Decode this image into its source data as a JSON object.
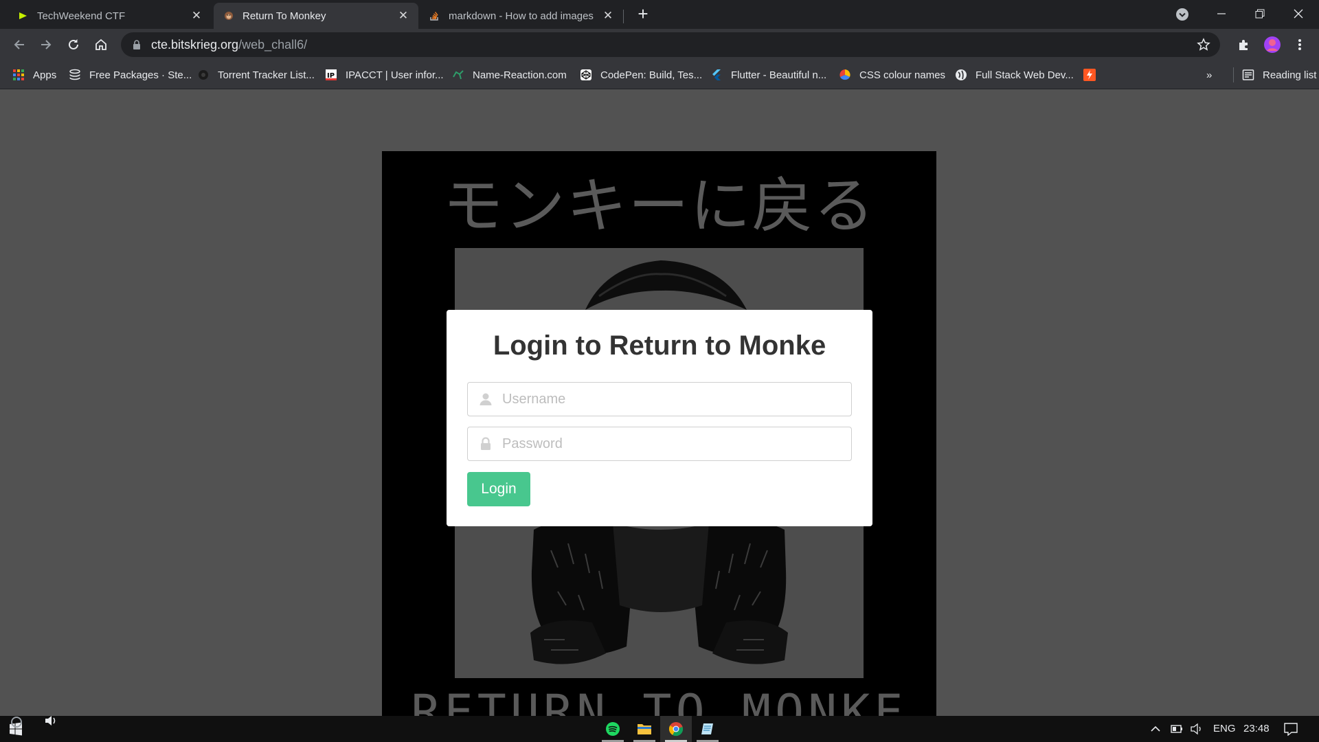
{
  "tabs": [
    {
      "title": "TechWeekend CTF",
      "active": false
    },
    {
      "title": "Return To Monkey",
      "active": true
    },
    {
      "title": "markdown - How to add images",
      "active": false
    }
  ],
  "omnibox": {
    "host": "cte.bitskrieg.org",
    "path": "/web_chall6/"
  },
  "bookmarks": [
    {
      "label": "Apps",
      "icon": "apps-grid-icon"
    },
    {
      "label": "Free Packages · Ste...",
      "icon": "stack-icon"
    },
    {
      "label": "Torrent Tracker List...",
      "icon": "torrent-icon"
    },
    {
      "label": "IPACCT | User infor...",
      "icon": "ipacct-icon"
    },
    {
      "label": "Name-Reaction.com",
      "icon": "molecule-icon"
    },
    {
      "label": "CodePen: Build, Tes...",
      "icon": "codepen-icon"
    },
    {
      "label": "Flutter - Beautiful n...",
      "icon": "flutter-icon"
    },
    {
      "label": "CSS colour names",
      "icon": "color-wheel-icon"
    },
    {
      "label": "Full Stack Web Dev...",
      "icon": "globe-icon"
    }
  ],
  "bookmarks_overflow": "»",
  "reading_list": "Reading list",
  "poster": {
    "jp_title": "モンキーに戻る",
    "en_title": "RETURN TO MONKE"
  },
  "login": {
    "title": "Login to Return to Monke",
    "username_placeholder": "Username",
    "password_placeholder": "Password",
    "button": "Login",
    "accent": "#48c78e"
  },
  "taskbar": {
    "lang": "ENG",
    "time": "23:48"
  }
}
